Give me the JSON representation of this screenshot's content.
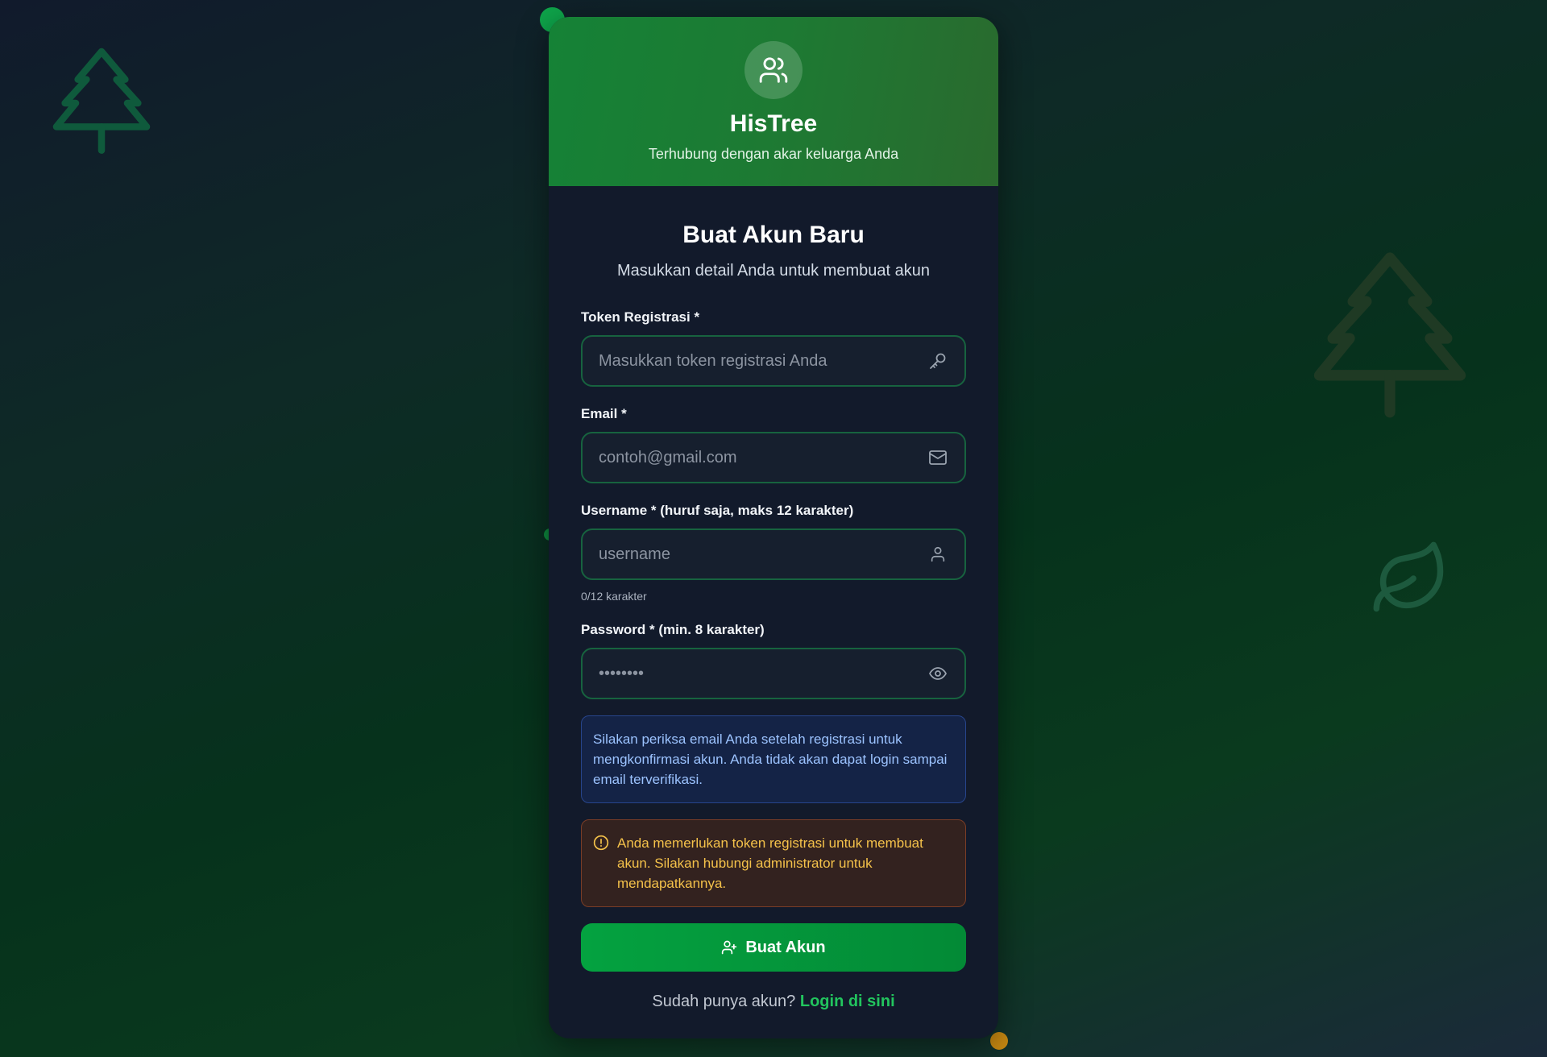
{
  "colors": {
    "accent": "#04a240",
    "header_green": "#158236",
    "info_text": "#9cc3ff",
    "warning_text": "#f5c24a",
    "link_green": "#22c55e"
  },
  "header": {
    "logo_icon": "users-icon",
    "brand": "HisTree",
    "tagline": "Terhubung dengan akar keluarga Anda"
  },
  "form": {
    "title": "Buat Akun Baru",
    "subtitle": "Masukkan detail Anda untuk membuat akun",
    "token": {
      "label": "Token Registrasi *",
      "placeholder": "Masukkan token registrasi Anda",
      "value": "",
      "icon": "key-icon"
    },
    "email": {
      "label": "Email *",
      "placeholder": "contoh@gmail.com",
      "value": "",
      "icon": "mail-icon"
    },
    "username": {
      "label": "Username * (huruf saja, maks 12 karakter)",
      "placeholder": "username",
      "value": "",
      "icon": "user-icon",
      "counter": "0/12 karakter"
    },
    "password": {
      "label": "Password * (min. 8 karakter)",
      "placeholder": "••••••••",
      "value": "",
      "icon": "eye-icon"
    },
    "info_message": "Silakan periksa email Anda setelah registrasi untuk mengkonfirmasi akun. Anda tidak akan dapat login sampai email terverifikasi.",
    "warning_message": "Anda memerlukan token registrasi untuk membuat akun. Silakan hubungi administrator untuk mendapatkannya.",
    "submit_label": "Buat Akun",
    "footer_text": "Sudah punya akun?",
    "login_link": "Login di sini"
  }
}
